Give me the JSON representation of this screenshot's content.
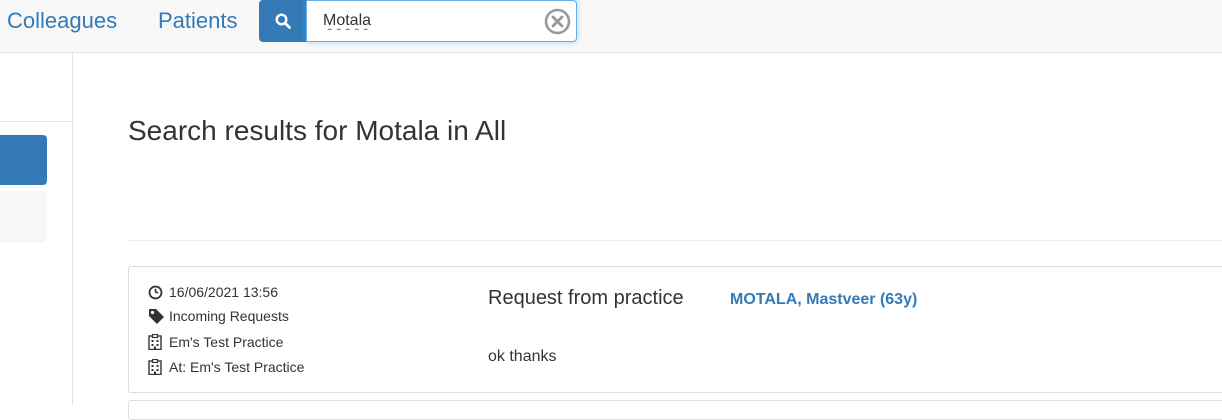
{
  "nav": {
    "colleagues": "Colleagues",
    "patients": "Patients"
  },
  "search": {
    "value": "Motala",
    "button_icon": "search-icon",
    "clear_icon": "clear-circle-icon"
  },
  "main": {
    "title": "Search results for Motala in All"
  },
  "results": [
    {
      "datetime": "16/06/2021 13:56",
      "category": "Incoming Requests",
      "practice": "Em's Test Practice",
      "at": "At: Em's Test Practice",
      "title": "Request from practice",
      "patient": "MOTALA, Mastveer (63y)",
      "body": "ok thanks"
    }
  ],
  "colors": {
    "accent": "#337ab7",
    "text": "#333333",
    "border": "#dddddd"
  }
}
